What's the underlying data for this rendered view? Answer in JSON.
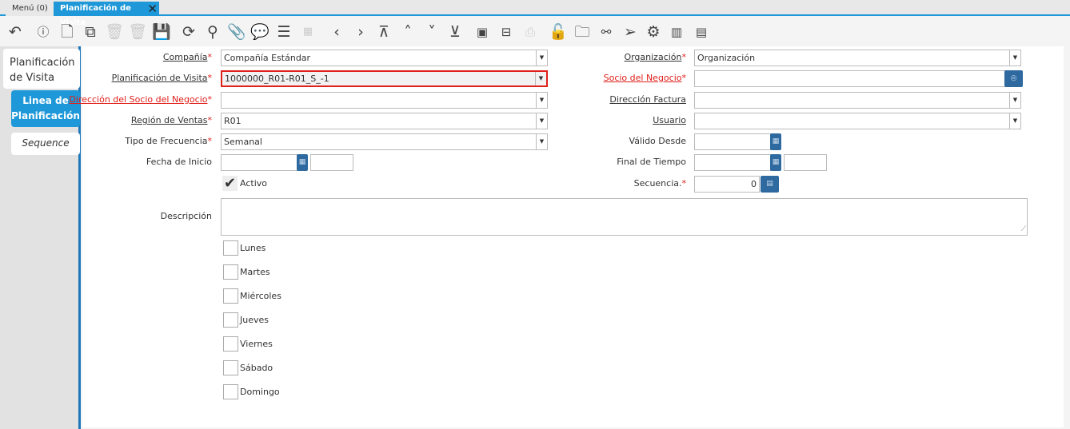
{
  "tabs": {
    "menu": "Menú (0)",
    "active": "Planificación de Visita"
  },
  "toolbar": [
    "undo-icon",
    "help-icon",
    "new-record-icon",
    "copy-record-icon",
    "delete-icon",
    "delete-selection-icon",
    "save-icon",
    "refresh-icon",
    "find-icon",
    "attachment-icon",
    "chat-icon",
    "grid-toggle-icon",
    "calendar-icon",
    "previous-record-icon",
    "next-record-icon",
    "first-record-icon",
    "parent-record-icon",
    "detail-record-icon",
    "last-record-icon",
    "report-icon",
    "archive-icon",
    "print-icon",
    "lock-icon",
    "zoom-across-icon",
    "workflow-icon",
    "send-icon",
    "process-icon",
    "product-info-icon",
    "request-icon"
  ],
  "side_tabs": {
    "header": "Planificación de Visita",
    "line": "Linea de Planificación",
    "sequence": "Sequence"
  },
  "form": {
    "company": {
      "label": "Compañía",
      "value": "Compañía Estándar"
    },
    "organization": {
      "label": "Organización",
      "value": "Organización"
    },
    "visit_plan": {
      "label": "Planificación de Visita",
      "value": "1000000_R01-R01_S_-1"
    },
    "business_partner": {
      "label": "Socio del Negocio",
      "value": ""
    },
    "bp_location": {
      "label": "Dirección del Socio del Negocio",
      "value": ""
    },
    "bill_location": {
      "label": "Dirección Factura",
      "value": ""
    },
    "sales_region": {
      "label": "Región de Ventas",
      "value": "R01"
    },
    "user": {
      "label": "Usuario",
      "value": ""
    },
    "frequency_type": {
      "label": "Tipo de Frecuencia",
      "value": "Semanal"
    },
    "valid_from": {
      "label": "Válido Desde",
      "value": ""
    },
    "start_date": {
      "label": "Fecha de Inicio",
      "value": ""
    },
    "end_time": {
      "label": "Final de Tiempo",
      "value": ""
    },
    "active": {
      "label": "Activo",
      "checked": true
    },
    "sequence": {
      "label": "Secuencia.",
      "value": "0"
    },
    "description": {
      "label": "Descripción",
      "value": ""
    },
    "days": [
      {
        "label": "Lunes",
        "checked": false
      },
      {
        "label": "Martes",
        "checked": false
      },
      {
        "label": "Miércoles",
        "checked": false
      },
      {
        "label": "Jueves",
        "checked": false
      },
      {
        "label": "Viernes",
        "checked": false
      },
      {
        "label": "Sábado",
        "checked": false
      },
      {
        "label": "Domingo",
        "checked": false
      }
    ]
  },
  "required_mark": "*"
}
